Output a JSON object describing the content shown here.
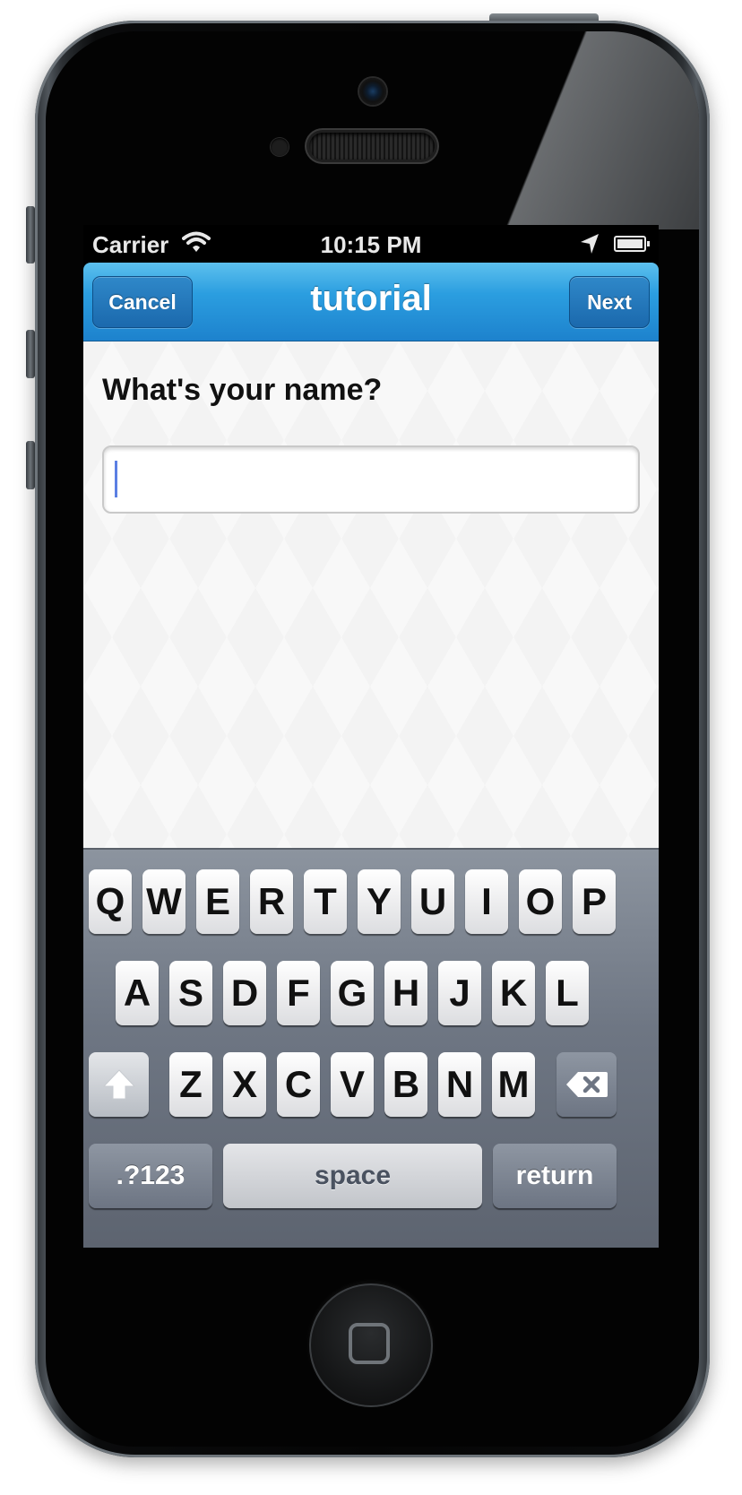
{
  "status_bar": {
    "carrier": "Carrier",
    "time": "10:15 PM",
    "wifi_icon": "wifi-icon",
    "location_icon": "location-arrow-icon",
    "battery_icon": "battery-icon"
  },
  "nav": {
    "title": "tutorial",
    "left_button": "Cancel",
    "right_button": "Next"
  },
  "form": {
    "question": "What's your name?",
    "name_value": "",
    "placeholder": ""
  },
  "keyboard": {
    "row1": [
      "Q",
      "W",
      "E",
      "R",
      "T",
      "Y",
      "U",
      "I",
      "O",
      "P"
    ],
    "row2": [
      "A",
      "S",
      "D",
      "F",
      "G",
      "H",
      "J",
      "K",
      "L"
    ],
    "row3": [
      "Z",
      "X",
      "C",
      "V",
      "B",
      "N",
      "M"
    ],
    "numbers_key": ".?123",
    "space_key": "space",
    "return_key": "return",
    "shift_icon": "shift-arrow-icon",
    "delete_icon": "delete-backspace-icon"
  },
  "colors": {
    "nav_bar": "#2b9ee0",
    "nav_button": "#1b69ad",
    "keyboard": "#6e7683",
    "caret": "#5b7fe3"
  }
}
